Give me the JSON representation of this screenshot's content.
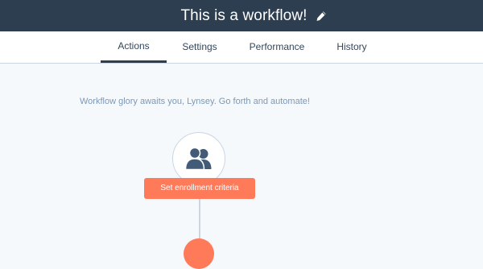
{
  "header": {
    "title": "This is a workflow!",
    "edit_icon": "pencil-icon"
  },
  "tabs": [
    {
      "label": "Actions",
      "active": true
    },
    {
      "label": "Settings",
      "active": false
    },
    {
      "label": "Performance",
      "active": false
    },
    {
      "label": "History",
      "active": false
    }
  ],
  "main": {
    "welcome_text": "Workflow glory awaits you, Lynsey. Go forth and automate!",
    "trigger_icon": "contacts-icon",
    "enroll_button_label": "Set enrollment criteria"
  },
  "colors": {
    "header_bg": "#2d3e50",
    "accent": "#ff7a59",
    "muted_text": "#7c98b6",
    "border": "#cbd6e2"
  }
}
